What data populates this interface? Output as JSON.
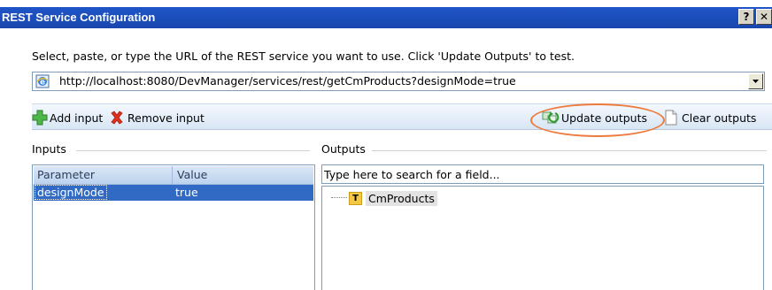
{
  "window": {
    "title": "REST Service Configuration",
    "help_button": "?",
    "close_button": "✕"
  },
  "instruction": "Select, paste, or type the URL of the REST service you want to use. Click 'Update Outputs' to test.",
  "url_field": {
    "value": "http://localhost:8080/DevManager/services/rest/getCmProducts?designMode=true",
    "icon": "internet-explorer-page-icon"
  },
  "toolbar": {
    "add_input_label": "Add input",
    "add_input_icon": "green-plus-icon",
    "remove_input_label": "Remove input",
    "remove_input_icon": "red-x-icon",
    "update_outputs_label": "Update outputs",
    "update_outputs_icon": "refresh-icon",
    "clear_outputs_label": "Clear outputs",
    "clear_outputs_icon": "blank-page-icon"
  },
  "inputs": {
    "group_label": "Inputs",
    "columns": [
      "Parameter",
      "Value"
    ],
    "rows": [
      {
        "parameter": "designMode",
        "value": "true"
      }
    ]
  },
  "outputs": {
    "group_label": "Outputs",
    "search_placeholder": "Type here to search for a field...",
    "tree": [
      {
        "type_badge": "T",
        "label": "CmProducts"
      }
    ]
  },
  "colors": {
    "titlebar": "#1f55c8",
    "selection": "#316ac5",
    "highlight_ellipse": "#ee7a3c"
  }
}
